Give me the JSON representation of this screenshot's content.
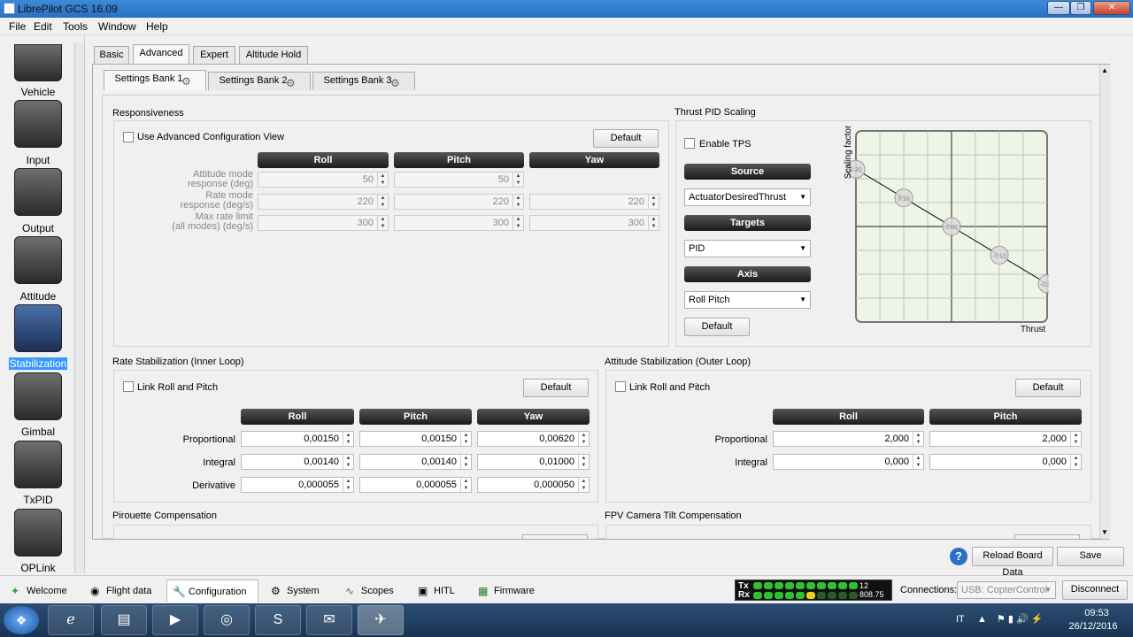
{
  "window": {
    "title": "LibrePilot GCS 16.09"
  },
  "menu": [
    "File",
    "Edit",
    "Tools",
    "Window",
    "Help"
  ],
  "sidebar": {
    "items": [
      {
        "label": "Vehicle",
        "icon": "vehicle-icon"
      },
      {
        "label": "Input",
        "icon": "transmitter-icon"
      },
      {
        "label": "Output",
        "icon": "motor-icon"
      },
      {
        "label": "Attitude",
        "icon": "attitude-icon"
      },
      {
        "label": "Stabilization",
        "icon": "stabilization-icon",
        "selected": true
      },
      {
        "label": "Gimbal",
        "icon": "camera-icon"
      },
      {
        "label": "TxPID",
        "icon": "meter-icon"
      },
      {
        "label": "OPLink",
        "icon": "antenna-icon"
      }
    ]
  },
  "tabs": [
    "Basic",
    "Advanced",
    "Expert",
    "Altitude Hold"
  ],
  "bank_tabs": [
    "Settings Bank 1",
    "Settings Bank 2",
    "Settings Bank 3"
  ],
  "responsiveness": {
    "title": "Responsiveness",
    "advanced_label": "Use Advanced Configuration View",
    "default_label": "Default",
    "headers": [
      "Roll",
      "Pitch",
      "Yaw"
    ],
    "rows": [
      {
        "label1": "Attitude mode",
        "label2": "response (deg)",
        "values": [
          "50",
          "50"
        ]
      },
      {
        "label1": "Rate mode",
        "label2": "response (deg/s)",
        "values": [
          "220",
          "220",
          "220"
        ]
      },
      {
        "label1": "Max rate limit",
        "label2": "(all modes) (deg/s)",
        "values": [
          "300",
          "300",
          "300"
        ]
      }
    ]
  },
  "thrust": {
    "title": "Thrust PID Scaling",
    "enable_label": "Enable TPS",
    "source_label": "Source",
    "source_value": "ActuatorDesiredThrust",
    "targets_label": "Targets",
    "targets_value": "PID",
    "axis_label": "Axis",
    "axis_value": "Roll Pitch",
    "default_label": "Default",
    "chart_ylabel": "Scaling factor",
    "chart_xlabel": "Thrust",
    "points": [
      "0.30",
      "0.15",
      "0.00",
      "-0.15",
      "-0.30"
    ]
  },
  "chart_data": {
    "type": "line",
    "x": [
      0,
      0.25,
      0.5,
      0.75,
      1.0
    ],
    "values": [
      0.3,
      0.15,
      0.0,
      -0.15,
      -0.3
    ],
    "xlabel": "Thrust",
    "ylabel": "Scaling factor",
    "ylim": [
      -0.5,
      0.5
    ],
    "grid": true
  },
  "rate": {
    "title": "Rate Stabilization (Inner Loop)",
    "link_label": "Link Roll and Pitch",
    "default_label": "Default",
    "headers": [
      "Roll",
      "Pitch",
      "Yaw"
    ],
    "rows": [
      {
        "label": "Proportional",
        "values": [
          "0,00150",
          "0,00150",
          "0,00620"
        ]
      },
      {
        "label": "Integral",
        "values": [
          "0,00140",
          "0,00140",
          "0,01000"
        ]
      },
      {
        "label": "Derivative",
        "values": [
          "0,000055",
          "0,000055",
          "0,000050"
        ]
      }
    ]
  },
  "attitude": {
    "title": "Attitude Stabilization (Outer Loop)",
    "link_label": "Link Roll and Pitch",
    "default_label": "Default",
    "headers": [
      "Roll",
      "Pitch"
    ],
    "rows": [
      {
        "label": "Proportional",
        "values": [
          "2,000",
          "2,000"
        ]
      },
      {
        "label": "Integral",
        "values": [
          "0,000",
          "0,000"
        ]
      }
    ]
  },
  "pirouette": {
    "title": "Pirouette Compensation"
  },
  "fpv": {
    "title": "FPV Camera Tilt Compensation"
  },
  "footer": {
    "reload_label": "Reload Board Data",
    "save_label": "Save"
  },
  "bottom_tabs": [
    "Welcome",
    "Flight data",
    "Configuration",
    "System",
    "Scopes",
    "HITL",
    "Firmware"
  ],
  "telemetry": {
    "tx_label": "Tx",
    "rx_label": "Rx",
    "tx_value": "12",
    "rx_value": "808.75"
  },
  "connections": {
    "label": "Connections:",
    "value": "USB: CopterControl",
    "disconnect_label": "Disconnect"
  },
  "taskbar": {
    "lang": "IT",
    "time": "09:53",
    "date": "26/12/2016"
  }
}
